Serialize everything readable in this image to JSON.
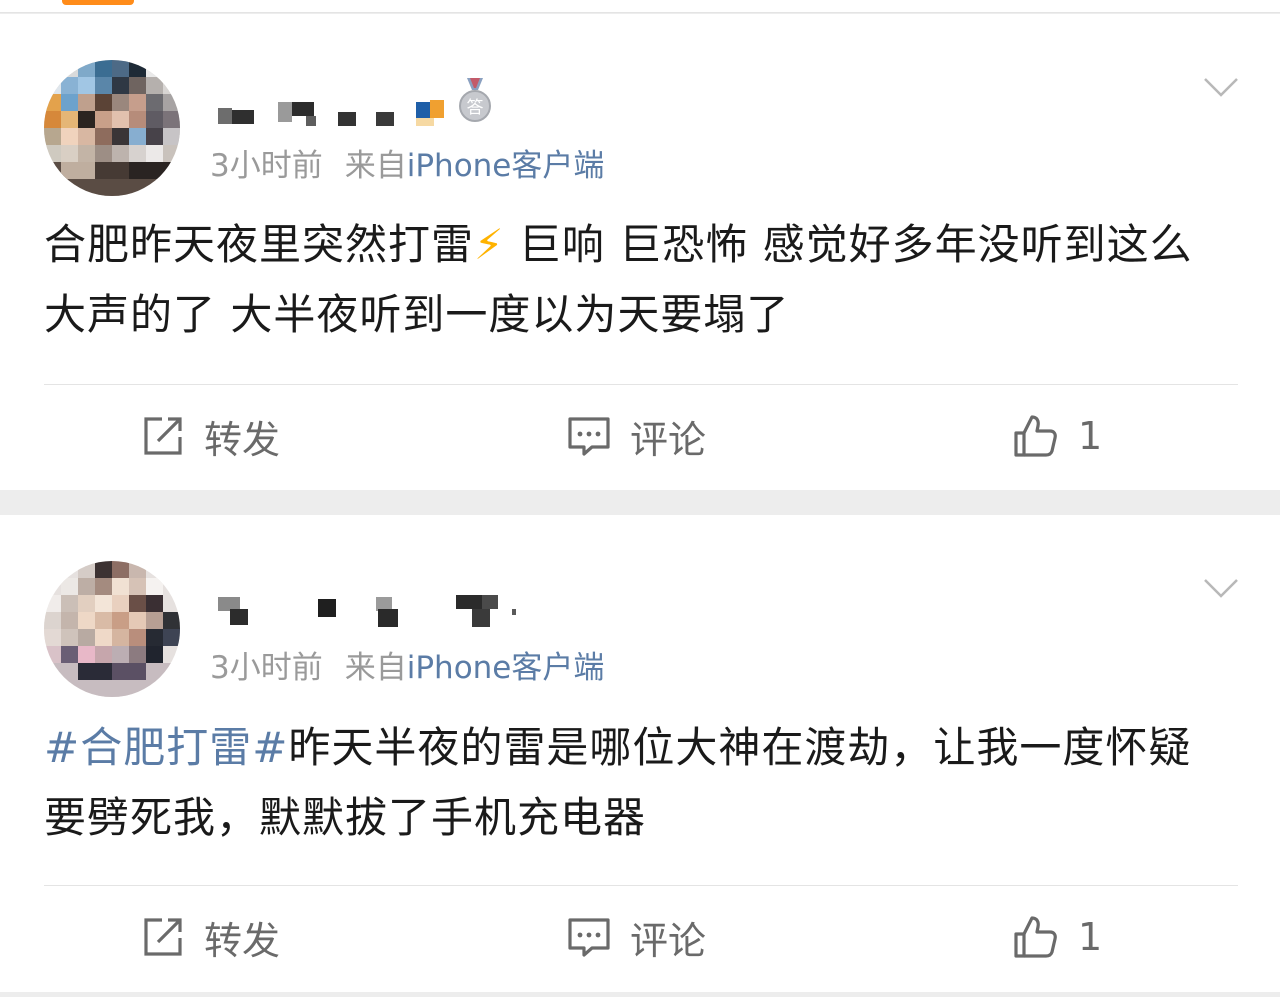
{
  "colors": {
    "background": "#ededed",
    "card": "#ffffff",
    "accent_link": "#5b7ca6",
    "meta_gray": "#9a9a9a",
    "text": "#1a1a1a",
    "top_tab_orange": "#ff8c1a"
  },
  "posts": [
    {
      "time": "3小时前",
      "source_prefix": "来自",
      "source": "iPhone客户端",
      "text_before": "合肥昨天夜里突然打雷",
      "emoji": "⚡",
      "text_after": " 巨响 巨恐怖 感觉好多年没听到这么大声的了 大半夜听到一度以为天要塌了",
      "hashtag": "",
      "actions": {
        "repost": "转发",
        "comment": "评论",
        "like_count": "1"
      },
      "icons": [
        "repost-icon",
        "comment-icon",
        "like-icon",
        "chevron-down-icon",
        "medal-badge-icon"
      ]
    },
    {
      "time": "3小时前",
      "source_prefix": "来自",
      "source": "iPhone客户端",
      "hashtag": "#合肥打雷#",
      "text": "昨天半夜的雷是哪位大神在渡劫，让我一度怀疑要劈死我，默默拔了手机充电器",
      "actions": {
        "repost": "转发",
        "comment": "评论",
        "like_count": "1"
      },
      "icons": [
        "repost-icon",
        "comment-icon",
        "like-icon",
        "chevron-down-icon"
      ]
    }
  ]
}
